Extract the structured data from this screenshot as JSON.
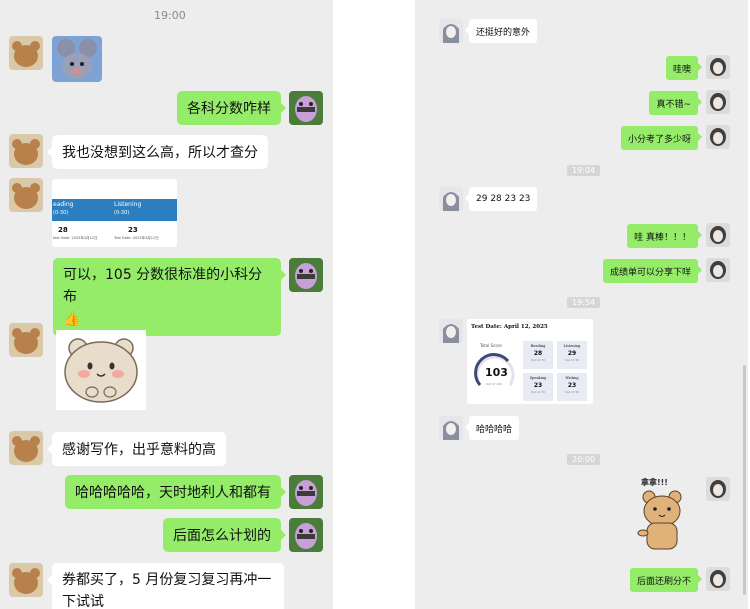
{
  "left_chat": {
    "status_time": "19:00",
    "messages": [
      {
        "side": "in",
        "type": "image",
        "desc_icon": "cartoon-mouse-image"
      },
      {
        "side": "out",
        "text": "各科分数咋样"
      },
      {
        "side": "in",
        "text": "我也没想到这么高，所以才查分"
      },
      {
        "side": "in",
        "type": "score-screenshot"
      },
      {
        "side": "out",
        "text": "可以，105 分数很标准的小科分布",
        "emoji": "👍"
      },
      {
        "side": "in",
        "type": "sticker",
        "desc_icon": "bear-sticker"
      },
      {
        "side": "in",
        "text": "感谢写作，出乎意料的高"
      },
      {
        "side": "out",
        "text": "哈哈哈哈哈，天时地利人和都有"
      },
      {
        "side": "out",
        "text": "后面怎么计划的"
      },
      {
        "side": "in",
        "text": "券都买了，5 月份复习复习再冲一下试试"
      }
    ],
    "score_card": {
      "col1_title": "eading",
      "col1_range": "(0-30)",
      "col2_title": "Listening",
      "col2_range": "(0-30)",
      "col1_score": "28",
      "col2_score": "23",
      "col1_date": "test Date: 2025年4月12日",
      "col2_date": "Test Date: 2025年4月12日"
    }
  },
  "right_chat": {
    "messages": [
      {
        "side": "in",
        "text": "还挺好的意外"
      },
      {
        "side": "out",
        "text": "哇噢"
      },
      {
        "side": "out",
        "text": "真不错~"
      },
      {
        "side": "out",
        "text": "小分考了多少呀"
      },
      {
        "side": "time",
        "text": "19:04"
      },
      {
        "side": "in",
        "text": "29 28 23 23"
      },
      {
        "side": "out",
        "text": "哇 真棒！！！"
      },
      {
        "side": "out",
        "text": "成绩单可以分享下咩"
      },
      {
        "side": "time",
        "text": "19:54"
      },
      {
        "side": "in",
        "type": "score-report"
      },
      {
        "side": "in",
        "text": "哈哈哈哈"
      },
      {
        "side": "time",
        "text": "20:00"
      },
      {
        "side": "out",
        "type": "sticker",
        "sticker_text": "拿拿!!!"
      },
      {
        "side": "out",
        "text": "后面还刷分不"
      }
    ],
    "report": {
      "title": "Test Date: April 12, 2025",
      "total_label": "Total Score",
      "total": "103",
      "total_sub": "Out of 120",
      "sections": [
        {
          "name": "Reading",
          "score": "28",
          "sub": "Out of 30"
        },
        {
          "name": "Listening",
          "score": "29",
          "sub": "Out of 30"
        },
        {
          "name": "Speaking",
          "score": "23",
          "sub": "Out of 30"
        },
        {
          "name": "Writing",
          "score": "23",
          "sub": "Out of 30"
        }
      ]
    }
  },
  "colors": {
    "bubble_out": "#95ec69",
    "bubble_in": "#ffffff",
    "bg": "#ededed",
    "accent_blue": "#2b7fc1"
  }
}
